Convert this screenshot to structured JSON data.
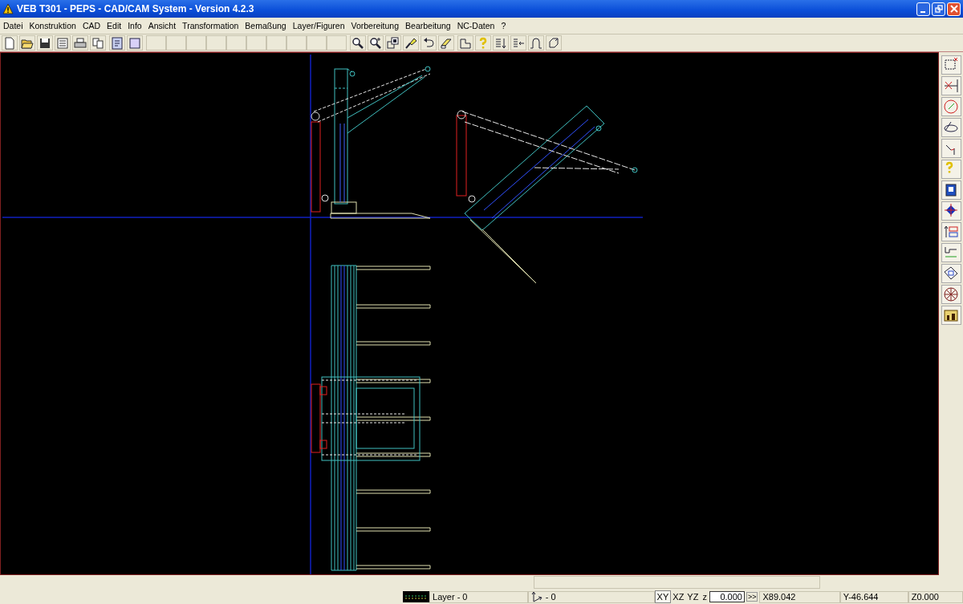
{
  "window": {
    "title": "VEB T301 - PEPS - CAD/CAM System - Version 4.2.3"
  },
  "menu": [
    "Datei",
    "Konstruktion",
    "CAD",
    "Edit",
    "Info",
    "Ansicht",
    "Transformation",
    "Bemaßung",
    "Layer/Figuren",
    "Vorbereitung",
    "Bearbeitung",
    "NC-Daten",
    "?"
  ],
  "toolbar": [
    [
      {
        "kind": "new"
      },
      {
        "kind": "open"
      },
      {
        "kind": "save"
      },
      {
        "kind": "panel"
      },
      {
        "kind": "print"
      },
      {
        "kind": "copy"
      }
    ],
    [
      {
        "kind": "page"
      },
      {
        "kind": "frame"
      }
    ],
    [
      {
        "kind": "empty"
      },
      {
        "kind": "empty"
      },
      {
        "kind": "empty"
      },
      {
        "kind": "empty"
      },
      {
        "kind": "empty"
      },
      {
        "kind": "empty"
      },
      {
        "kind": "empty"
      },
      {
        "kind": "empty"
      },
      {
        "kind": "empty"
      },
      {
        "kind": "empty"
      }
    ],
    [
      {
        "kind": "zoom"
      },
      {
        "kind": "zoomplus"
      },
      {
        "kind": "zoomwin"
      },
      {
        "kind": "brush"
      },
      {
        "kind": "undo"
      },
      {
        "kind": "eraser"
      }
    ],
    [
      {
        "kind": "shape"
      },
      {
        "kind": "help"
      },
      {
        "kind": "sortdown"
      },
      {
        "kind": "sortleft"
      },
      {
        "kind": "profile"
      },
      {
        "kind": "refresh"
      }
    ]
  ],
  "tool_palette": [
    {
      "kind": "rect"
    },
    {
      "kind": "point"
    },
    {
      "kind": "circle"
    },
    {
      "kind": "ellipse"
    },
    {
      "kind": "fillet"
    },
    {
      "kind": "help"
    },
    {
      "kind": "book"
    },
    {
      "kind": "center"
    },
    {
      "kind": "blocks"
    },
    {
      "kind": "dimension"
    },
    {
      "kind": "sheets"
    },
    {
      "kind": "wheel"
    },
    {
      "kind": "machine"
    }
  ],
  "status_bar": {
    "layer": "Layer - 0",
    "axis": "- 0",
    "planes": [
      {
        "label": "XY",
        "selected": true
      },
      {
        "label": "XZ",
        "selected": false
      },
      {
        "label": "YZ",
        "selected": false
      }
    ],
    "z_label": "z",
    "z_value": "0.000",
    "apply": ">>",
    "x": "X89.042",
    "y": "Y-46.644",
    "z": "Z0.000"
  }
}
